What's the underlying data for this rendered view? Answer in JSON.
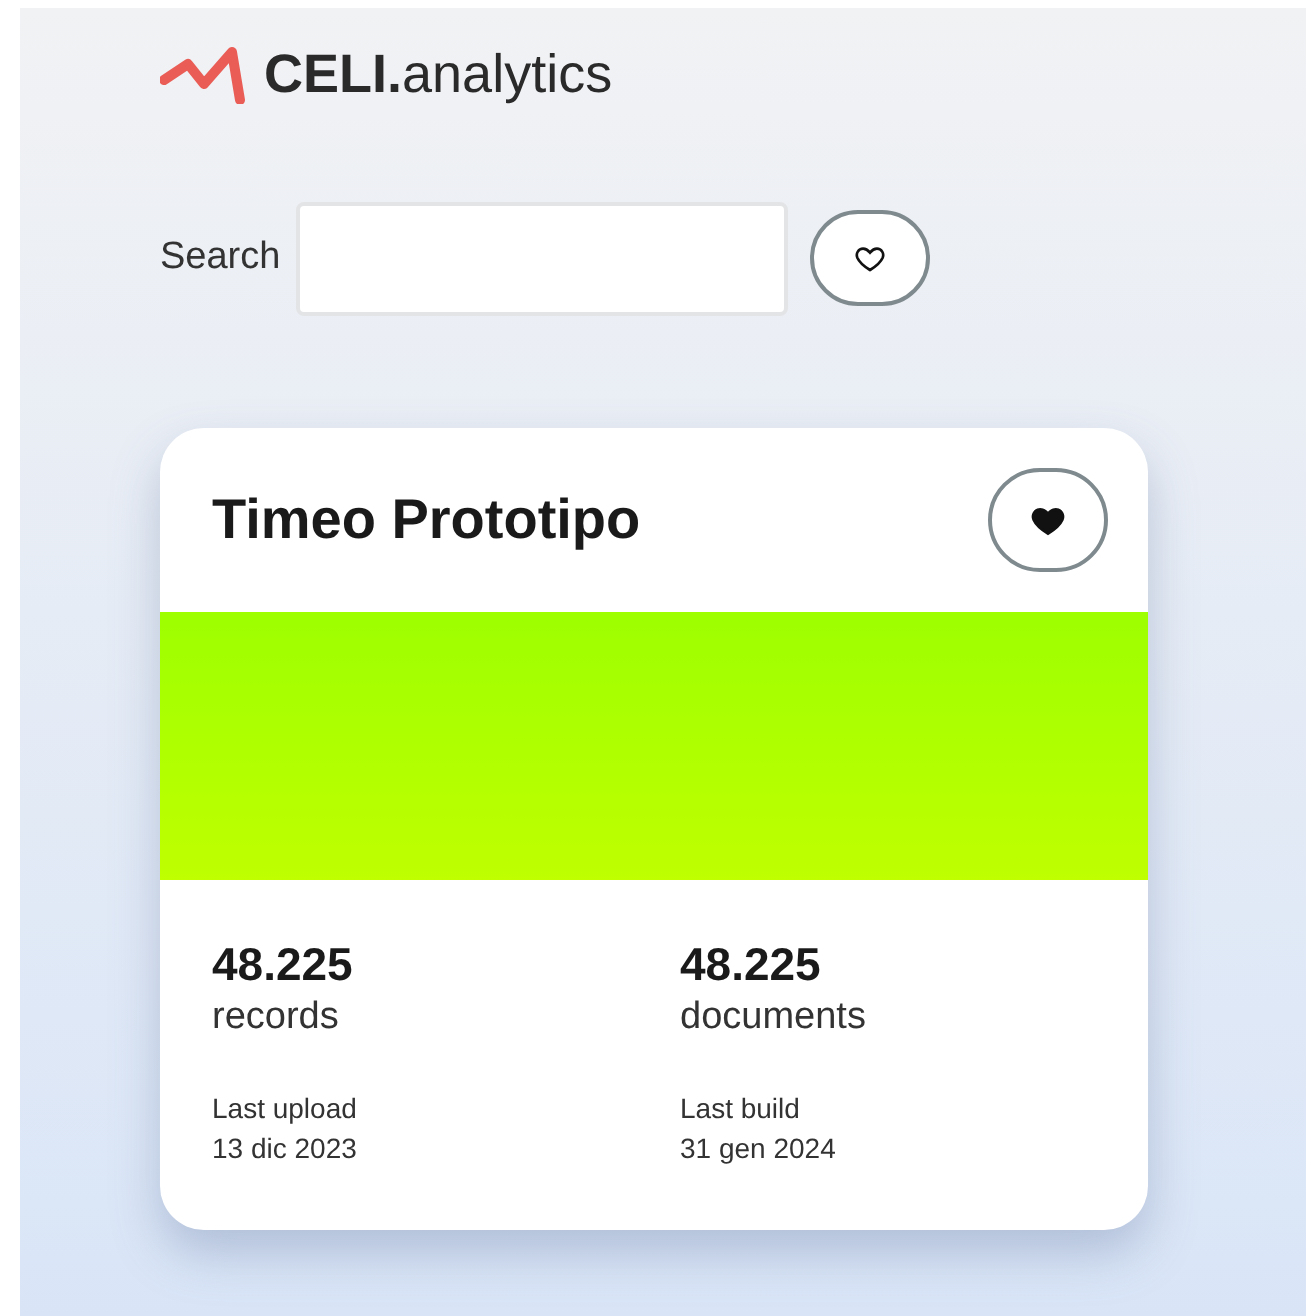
{
  "logo": {
    "text": "**CELI.**analytics"
  },
  "search": {
    "label": "Search",
    "favorites_only": false
  },
  "card": {
    "title": "Timeo Prototipo",
    "favorite": true,
    "stats": [
      {
        "value": "48.225",
        "label": "records"
      },
      {
        "value": "48.225",
        "label": "documents"
      }
    ],
    "dates": [
      {
        "label": "Last upload",
        "value": "13 dic 2023"
      },
      {
        "label": "Last build",
        "value": "31 gen 2024"
      }
    ]
  }
}
